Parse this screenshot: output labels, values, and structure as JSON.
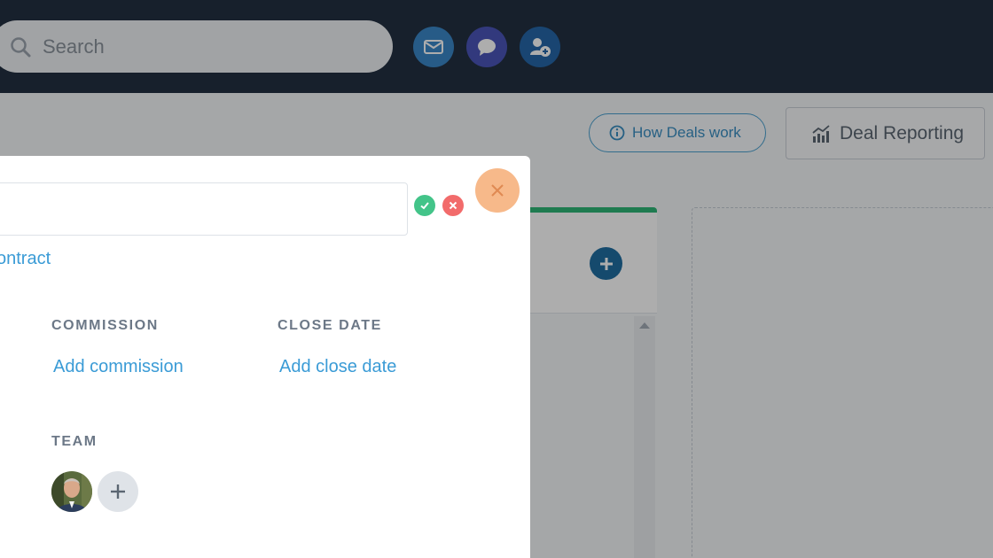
{
  "header": {
    "search": {
      "placeholder": "Search",
      "icon": "search-icon"
    },
    "buttons": [
      {
        "name": "email-button",
        "icon": "envelope-icon",
        "color": "#3a86c8"
      },
      {
        "name": "chat-button",
        "icon": "chat-bubble-icon",
        "color": "#4a55b8"
      },
      {
        "name": "add-contact-button",
        "icon": "add-user-icon",
        "color": "#2566a8"
      }
    ],
    "background_color": "#223041"
  },
  "toolbar": {
    "how_deals_work_label": "How Deals work",
    "deal_reporting_label": "Deal Reporting"
  },
  "modal": {
    "title_value": "",
    "contract_link": "ontract",
    "commission": {
      "label": "COMMISSION",
      "link": "Add commission"
    },
    "close_date": {
      "label": "CLOSE DATE",
      "link": "Add close date"
    },
    "team": {
      "label": "TEAM"
    }
  },
  "colors": {
    "accent_blue": "#3a9bd6",
    "stage_green": "#2eb577",
    "confirm_green": "#43c489",
    "cancel_red": "#f26b6b",
    "close_orange": "#f7b98a"
  }
}
